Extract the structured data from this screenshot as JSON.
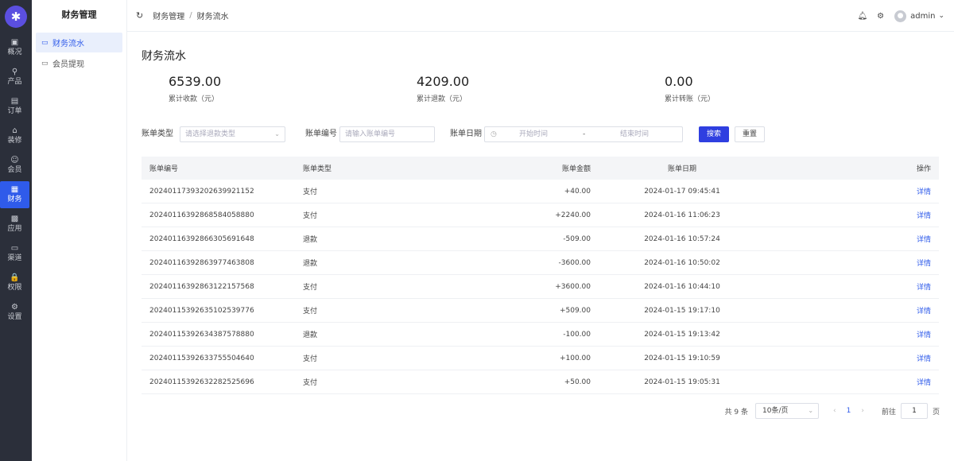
{
  "nav": {
    "items": [
      {
        "label": "概况",
        "icon": "dashboard-icon",
        "glyph": "▣"
      },
      {
        "label": "产品",
        "icon": "product-icon",
        "glyph": "⚲"
      },
      {
        "label": "订单",
        "icon": "order-icon",
        "glyph": "▤"
      },
      {
        "label": "装修",
        "icon": "decorate-icon",
        "glyph": "⌂"
      },
      {
        "label": "会员",
        "icon": "member-icon",
        "glyph": "☺"
      },
      {
        "label": "财务",
        "icon": "finance-icon",
        "glyph": "▦"
      },
      {
        "label": "应用",
        "icon": "apps-icon",
        "glyph": "▩"
      },
      {
        "label": "渠道",
        "icon": "channel-icon",
        "glyph": "▭"
      },
      {
        "label": "权限",
        "icon": "lock-icon",
        "glyph": "🔒"
      },
      {
        "label": "设置",
        "icon": "settings-icon",
        "glyph": "⚙"
      }
    ],
    "active_index": 5
  },
  "sidebar": {
    "title": "财务管理",
    "items": [
      {
        "label": "财务流水"
      },
      {
        "label": "会员提现"
      }
    ]
  },
  "header": {
    "breadcrumb": [
      "财务管理",
      "财务流水"
    ],
    "breadcrumb_sep": "/",
    "username": "admin"
  },
  "page": {
    "title": "财务流水",
    "stats": [
      {
        "value": "6539.00",
        "label": "累计收款（元）"
      },
      {
        "value": "4209.00",
        "label": "累计退款（元）"
      },
      {
        "value": "0.00",
        "label": "累计转账（元）"
      }
    ]
  },
  "filters": {
    "type_label": "账单类型",
    "type_placeholder": "请选择退款类型",
    "number_label": "账单编号",
    "number_placeholder": "请输入账单编号",
    "date_label": "账单日期",
    "date_start": "开始时间",
    "date_sep": "-",
    "date_end": "结束时间",
    "search_button": "搜索",
    "reset_button": "重置"
  },
  "table": {
    "columns": [
      "账单编号",
      "账单类型",
      "账单金额",
      "账单日期",
      "操作"
    ],
    "rows": [
      {
        "no": "20240117393202639921152",
        "type": "支付",
        "amount": "+40.00",
        "date": "2024-01-17 09:45:41",
        "action": "详情"
      },
      {
        "no": "20240116392868584058880",
        "type": "支付",
        "amount": "+2240.00",
        "date": "2024-01-16 11:06:23",
        "action": "详情"
      },
      {
        "no": "20240116392866305691648",
        "type": "退款",
        "amount": "-509.00",
        "date": "2024-01-16 10:57:24",
        "action": "详情"
      },
      {
        "no": "20240116392863977463808",
        "type": "退款",
        "amount": "-3600.00",
        "date": "2024-01-16 10:50:02",
        "action": "详情"
      },
      {
        "no": "20240116392863122157568",
        "type": "支付",
        "amount": "+3600.00",
        "date": "2024-01-16 10:44:10",
        "action": "详情"
      },
      {
        "no": "20240115392635102539776",
        "type": "支付",
        "amount": "+509.00",
        "date": "2024-01-15 19:17:10",
        "action": "详情"
      },
      {
        "no": "20240115392634387578880",
        "type": "退款",
        "amount": "-100.00",
        "date": "2024-01-15 19:13:42",
        "action": "详情"
      },
      {
        "no": "20240115392633755504640",
        "type": "支付",
        "amount": "+100.00",
        "date": "2024-01-15 19:10:59",
        "action": "详情"
      },
      {
        "no": "20240115392632282525696",
        "type": "支付",
        "amount": "+50.00",
        "date": "2024-01-15 19:05:31",
        "action": "详情"
      }
    ]
  },
  "pagination": {
    "total_text": "共 9 条",
    "page_size": "10条/页",
    "current_page": "1",
    "goto_label": "前往",
    "goto_value": "1",
    "page_suffix": "页"
  },
  "colors": {
    "nav_bg": "#2b2f3a",
    "accent": "#2f5bea",
    "primary_button": "#2f3fe0"
  }
}
